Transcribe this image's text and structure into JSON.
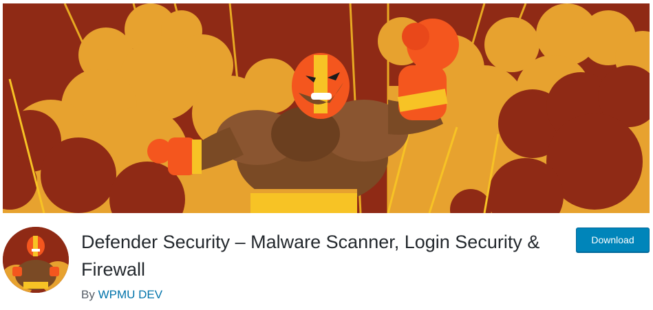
{
  "plugin": {
    "title": "Defender Security – Malware Scanner, Login Security & Firewall",
    "by_label": "By",
    "author": "WPMU DEV"
  },
  "actions": {
    "download_label": "Download"
  },
  "colors": {
    "banner_dark_red": "#8f2a15",
    "banner_orange": "#e7a22f",
    "banner_yellow": "#f7c325",
    "mask_orange": "#f4561e",
    "skin_brown": "#7a4a25",
    "download_blue": "#0085ba",
    "link_blue": "#0073aa"
  },
  "icons": {
    "banner": "wrestler-banner-illustration",
    "plugin_icon": "wrestler-avatar-icon"
  }
}
